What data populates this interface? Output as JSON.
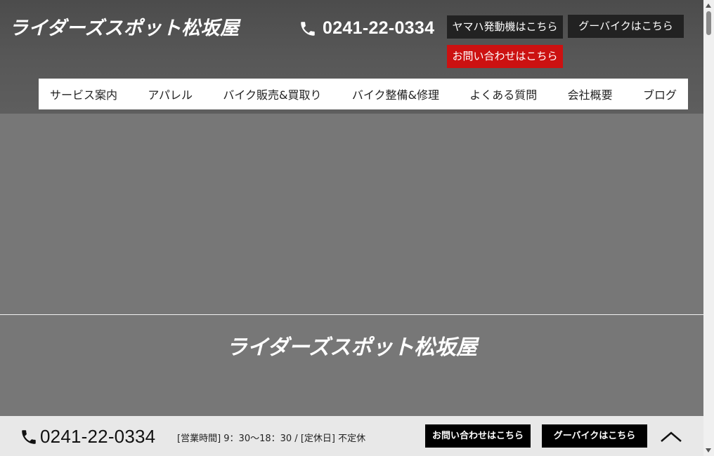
{
  "header": {
    "logo": "ライダーズスポット松坂屋",
    "phone_icon": "phone-icon",
    "phone": "0241-22-0334",
    "buttons": {
      "yamaha": "ヤマハ発動機はこちら",
      "goobike": "グーバイクはこちら",
      "contact": "お問い合わせはこちら"
    },
    "nav": [
      "サービス案内",
      "アパレル",
      "バイク販売&買取り",
      "バイク整備&修理",
      "よくある質問",
      "会社概要",
      "ブログ"
    ]
  },
  "hero": {
    "title": "ライダーズスポット松坂屋"
  },
  "footer_bar": {
    "phone": "0241-22-0334",
    "hours": "[営業時間] 9：30〜18：30 / [定休日] 不定休",
    "contact": "お問い合わせはこちら",
    "goobike": "グーバイクはこちら",
    "to_top_icon": "chevron-up-icon"
  },
  "colors": {
    "header_bg": "#555555",
    "hero_bg": "#777777",
    "button_dark": "#222222",
    "button_red": "#cc1111",
    "bottom_bar_bg": "#e8e8e8"
  }
}
